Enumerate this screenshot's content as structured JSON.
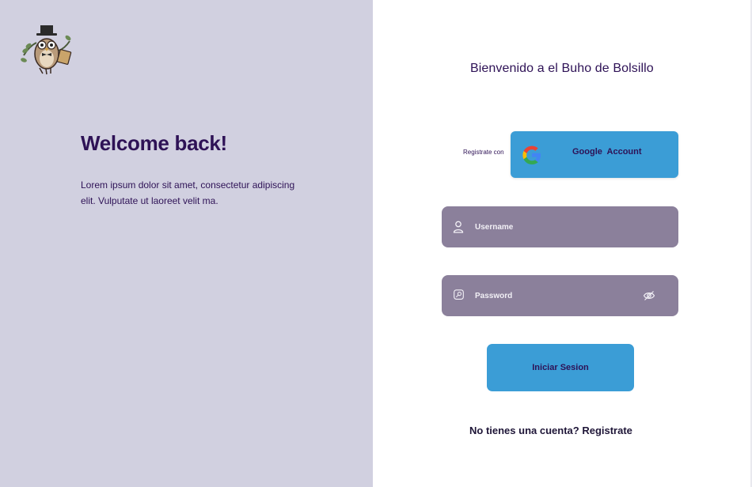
{
  "left": {
    "logo_icon": "owl-mascot-icon",
    "title": "Welcome back!",
    "text": "Lorem ipsum dolor sit amet, consectetur adipiscing elit. Vulputate ut laoreet velit ma."
  },
  "form": {
    "title": "Bienvenido a el Buho de Bolsillo",
    "google": {
      "prefix": "Registrate con",
      "label": "Google  Account",
      "icon": "google-icon"
    },
    "username": {
      "placeholder": "Username",
      "icon": "user-icon"
    },
    "password": {
      "placeholder": "Password",
      "icon": "key-icon",
      "toggle_icon": "eye-off-icon"
    },
    "submit_label": "Iniciar Sesion",
    "register_prompt": "No tienes una cuenta?",
    "register_link": "Registrate"
  },
  "colors": {
    "left_bg": "#d1d0e0",
    "accent_blue": "#3b9dd6",
    "field_bg": "#8b809b",
    "text_purple": "#2e1256"
  }
}
